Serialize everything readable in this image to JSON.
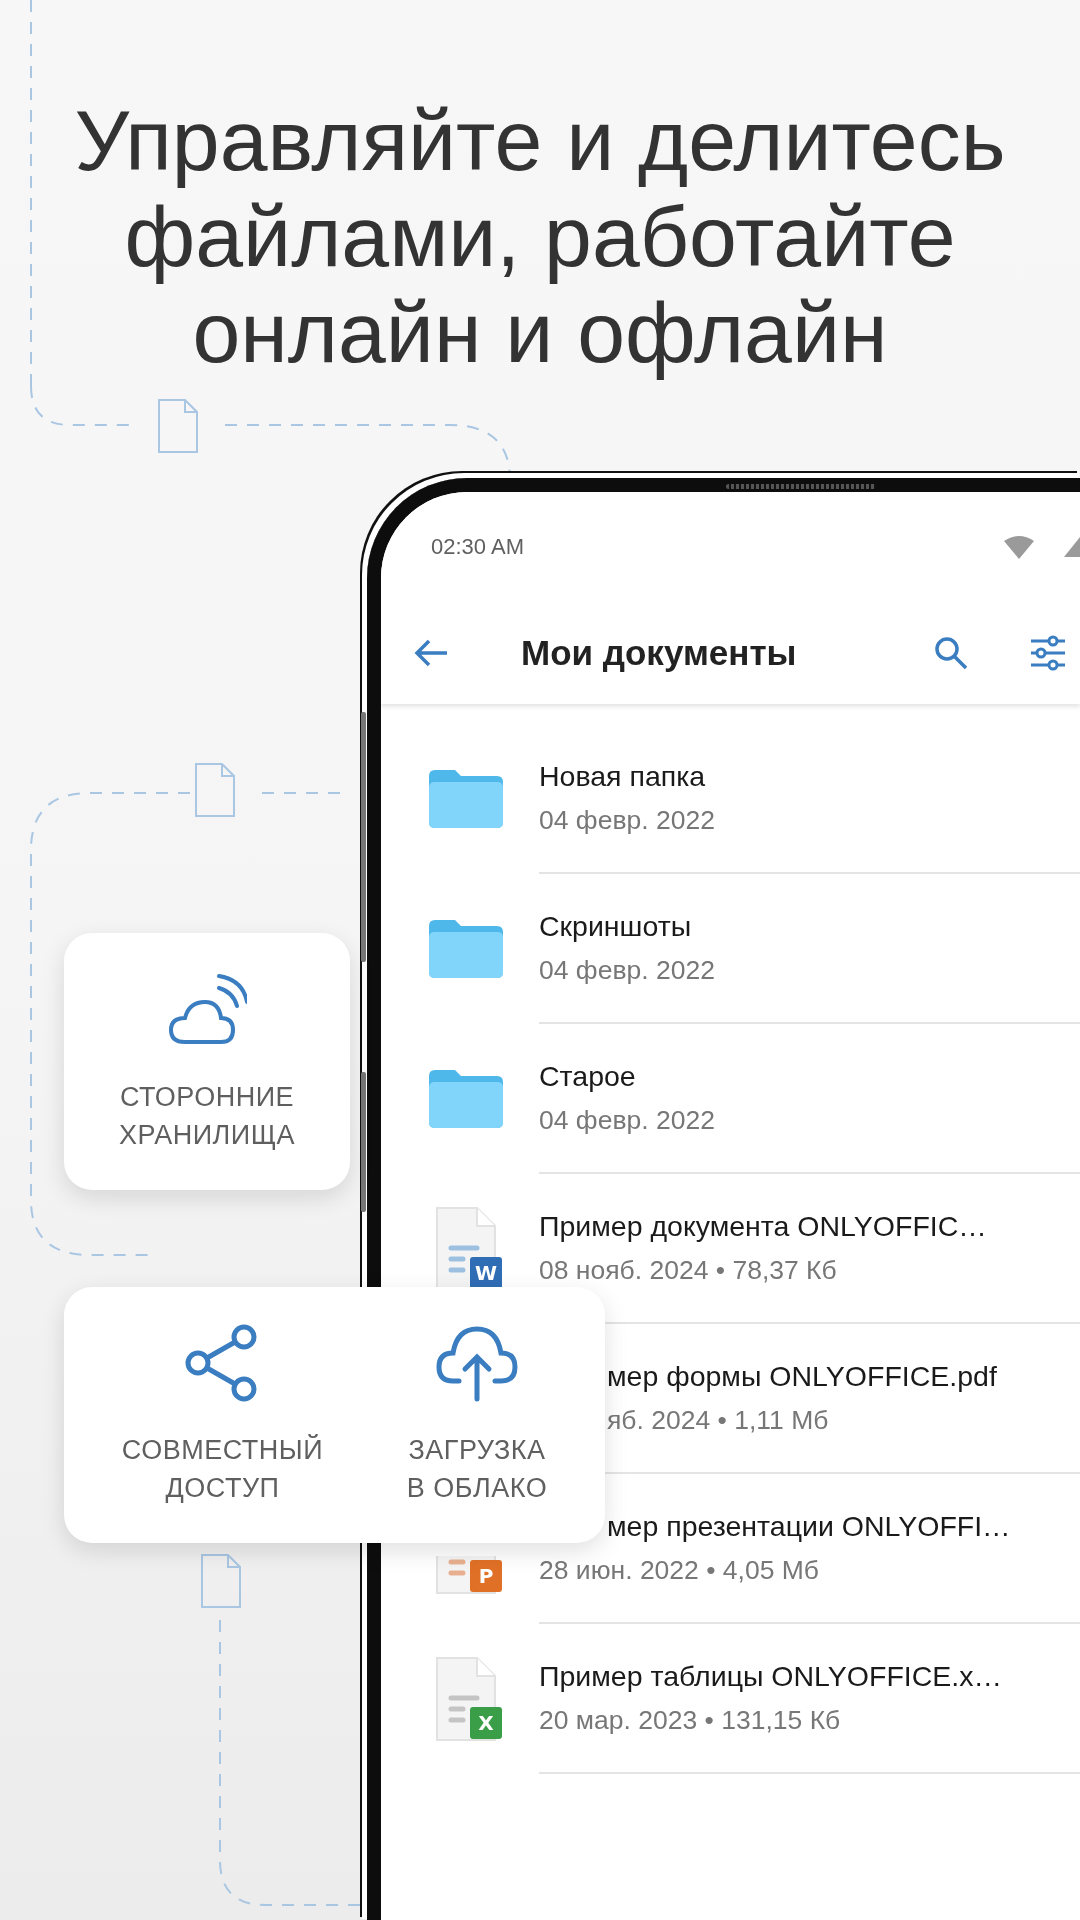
{
  "headline_lines": [
    "Управляйте и делитесь",
    "файлами, работайте",
    "онлайн и офлайн"
  ],
  "phone": {
    "status_time": "02:30 AM",
    "toolbar": {
      "title": "Мои документы"
    },
    "rows": [
      {
        "kind": "folder",
        "title": "Новая папка",
        "meta": "04 февр. 2022"
      },
      {
        "kind": "folder",
        "title": "Скриншоты",
        "meta": "04 февр. 2022"
      },
      {
        "kind": "folder",
        "title": "Старое",
        "meta": "04 февр. 2022"
      },
      {
        "kind": "doc",
        "badge": "W",
        "title": "Пример документа ONLYOFFIC…",
        "meta": "08 нояб. 2024 • 78,37 Кб"
      },
      {
        "title": "мер формы ONLYOFFICE.pdf",
        "meta": "яб. 2024 • 1,11 Мб",
        "title_occluded": true,
        "meta_occluded": true
      },
      {
        "kind": "ppt",
        "badge": "P",
        "title": "мер презентации ONLYOFFI…",
        "meta": "28 июн. 2022 • 4,05 Мб",
        "title_occluded": true
      },
      {
        "kind": "xls",
        "badge": "X",
        "title": "Пример таблицы ONLYOFFICE.x…",
        "meta": "20 мар. 2023 • 131,15 Кб"
      }
    ]
  },
  "feature_cards": [
    {
      "items": [
        {
          "kind": "cloud-signal",
          "label_lines": [
            "СТОРОННИЕ",
            "ХРАНИЛИЩА"
          ]
        }
      ]
    },
    {
      "items": [
        {
          "kind": "share",
          "label_lines": [
            "СОВМЕСТНЫЙ",
            "ДОСТУП"
          ]
        },
        {
          "kind": "cloud-upload",
          "label_lines": [
            "ЗАГРУЗКА",
            "В ОБЛАКО"
          ]
        }
      ]
    }
  ]
}
